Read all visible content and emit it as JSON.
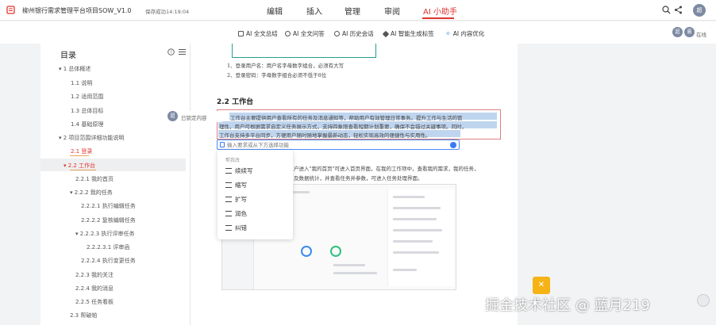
{
  "header": {
    "doc_title": "柳州银行需求管理平台项目SOW_V1.0",
    "save_status": "保存成功14:19:04",
    "tabs": [
      {
        "label": "编辑"
      },
      {
        "label": "插入"
      },
      {
        "label": "管理"
      },
      {
        "label": "审阅"
      },
      {
        "label": "AI 小助手"
      }
    ],
    "active_tab": "AI 小助手",
    "user_avatar": "超"
  },
  "toolbar": {
    "items": [
      {
        "label": "AI 全文总结",
        "icon": "doc-icon"
      },
      {
        "label": "AI 全文问答",
        "icon": "question-icon"
      },
      {
        "label": "AI 历史会话",
        "icon": "clock-icon"
      },
      {
        "label": "AI 智能生成标签",
        "icon": "tag-icon"
      },
      {
        "label": "AI 内容优化",
        "icon": "sparkle-icon"
      }
    ],
    "online_avatars": [
      "超",
      "晨"
    ],
    "online_label": "在线"
  },
  "sidebar": {
    "title": "目录",
    "items": [
      {
        "label": "1 总体概述"
      },
      {
        "label": "1.1 说明"
      },
      {
        "label": "1.2 适用范围"
      },
      {
        "label": "1.3 总体目标"
      },
      {
        "label": "1.4 基础原理"
      },
      {
        "label": "2 项目范围详细功能说明"
      },
      {
        "label": "2.1 登录"
      },
      {
        "label": "2.2 工作台"
      },
      {
        "label": "2.2.1 我的首页"
      },
      {
        "label": "2.2.2 我的任务"
      },
      {
        "label": "2.2.2.1 执行编辑任务"
      },
      {
        "label": "2.2.2.2 复核编辑任务"
      },
      {
        "label": "2.2.2.3 执行评审任务"
      },
      {
        "label": "2.2.2.3.1 评审函"
      },
      {
        "label": "2.2.2.4 执行变更任务"
      },
      {
        "label": "2.2.3 我的关注"
      },
      {
        "label": "2.2.4 我的消息"
      },
      {
        "label": "2.2.5 任务看板"
      },
      {
        "label": "2.3 帮破帕"
      }
    ]
  },
  "doc": {
    "login_line_1": "1、登录用户名：用户名字母数字组合，必须有大写",
    "login_line_2": "2、登录密码：字母数字组合必须不低于8位",
    "section_heading": "2.2 工作台",
    "selected_line_1": "工作台主要提供用户查看所有的任务及消息通知等，帮助用户有效管理日常事务。提升工作与生活的管",
    "selected_line_2": "理性，用户可根据需求自定义任务展示方式，支持四象限查看短期计划重要，确保不会错过关键事项。同时，",
    "selected_line_3": "工作台支持多平台同步，方便用户随时随地掌握最新动态，轻松实现高效的便捷性与实用性。",
    "body_line_1": "户进入\"我的首页\"可进入首页界面，在我的工作项中，查看我的需求，我的任务，",
    "body_line_2": "及数据统计，并查看任务并参数，可进入任务处理界面。",
    "ai_input_placeholder": "输入要求或从下方选择功能",
    "popup_header": "帮我改",
    "popup_items": [
      {
        "label": "续续写",
        "icon": "continue-write-icon"
      },
      {
        "label": "缩写",
        "icon": "shorten-icon"
      },
      {
        "label": "扩写",
        "icon": "expand-icon"
      },
      {
        "label": "润色",
        "icon": "polish-icon"
      },
      {
        "label": "纠错",
        "icon": "correct-icon"
      }
    ],
    "locked_avatar": "超",
    "locked_label": "已锁定内容"
  },
  "watermark": "掘金技术社区 @ 蓝月219"
}
